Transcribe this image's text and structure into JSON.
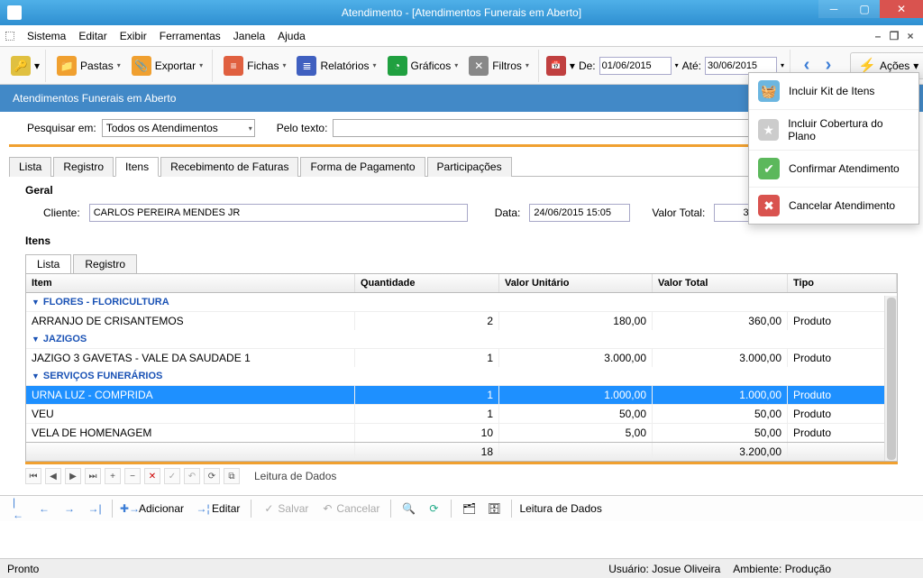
{
  "window": {
    "title": "Atendimento - [Atendimentos Funerais em Aberto]"
  },
  "menu": {
    "items": [
      "Sistema",
      "Editar",
      "Exibir",
      "Ferramentas",
      "Janela",
      "Ajuda"
    ]
  },
  "toolbar": {
    "pastas": "Pastas",
    "exportar": "Exportar",
    "fichas": "Fichas",
    "relatorios": "Relatórios",
    "graficos": "Gráficos",
    "filtros": "Filtros",
    "de_label": "De:",
    "de_value": "01/06/2015",
    "ate_label": "Até:",
    "ate_value": "30/06/2015",
    "acoes": "Ações"
  },
  "section_title": "Atendimentos Funerais em Aberto",
  "search": {
    "pesquisar_em": "Pesquisar em:",
    "combo_value": "Todos os Atendimentos",
    "pelo_texto": "Pelo texto:",
    "texto_value": ""
  },
  "maintabs": [
    "Lista",
    "Registro",
    "Itens",
    "Recebimento de Faturas",
    "Forma de Pagamento",
    "Participações"
  ],
  "active_maintab": 2,
  "geral": {
    "title": "Geral",
    "cliente_label": "Cliente:",
    "cliente_value": "CARLOS PEREIRA MENDES JR",
    "data_label": "Data:",
    "data_value": "24/06/2015 15:05",
    "valor_total_label": "Valor Total:",
    "valor_total_value": "3.200,00"
  },
  "itens": {
    "title": "Itens",
    "subtabs": [
      "Lista",
      "Registro"
    ],
    "columns": [
      "Item",
      "Quantidade",
      "Valor Unitário",
      "Valor Total",
      "Tipo"
    ],
    "groups": [
      {
        "name": "FLORES - FLORICULTURA",
        "rows": [
          {
            "item": "ARRANJO DE CRISANTEMOS",
            "qtd": "2",
            "vu": "180,00",
            "vt": "360,00",
            "tipo": "Produto",
            "selected": false
          }
        ]
      },
      {
        "name": "JAZIGOS",
        "rows": [
          {
            "item": "JAZIGO 3 GAVETAS - VALE DA SAUDADE 1",
            "qtd": "1",
            "vu": "3.000,00",
            "vt": "3.000,00",
            "tipo": "Produto",
            "selected": false
          }
        ]
      },
      {
        "name": "SERVIÇOS FUNERÁRIOS",
        "rows": [
          {
            "item": "URNA LUZ - COMPRIDA",
            "qtd": "1",
            "vu": "1.000,00",
            "vt": "1.000,00",
            "tipo": "Produto",
            "selected": true
          },
          {
            "item": "VEU",
            "qtd": "1",
            "vu": "50,00",
            "vt": "50,00",
            "tipo": "Produto",
            "selected": false
          },
          {
            "item": "VELA DE HOMENAGEM",
            "qtd": "10",
            "vu": "5,00",
            "vt": "50,00",
            "tipo": "Produto",
            "selected": false
          }
        ]
      }
    ],
    "total_qtd": "18",
    "total_vt": "3.200,00",
    "nav_label": "Leitura de Dados"
  },
  "bottom": {
    "adicionar": "Adicionar",
    "editar": "Editar",
    "salvar": "Salvar",
    "cancelar": "Cancelar",
    "leitura": "Leitura de Dados"
  },
  "actions_menu": [
    "Incluir Kit de Itens",
    "Incluir Cobertura do Plano",
    "Confirmar Atendimento",
    "Cancelar Atendimento"
  ],
  "status": {
    "pronto": "Pronto",
    "usuario": "Usuário: Josue Oliveira",
    "ambiente": "Ambiente: Produção"
  }
}
